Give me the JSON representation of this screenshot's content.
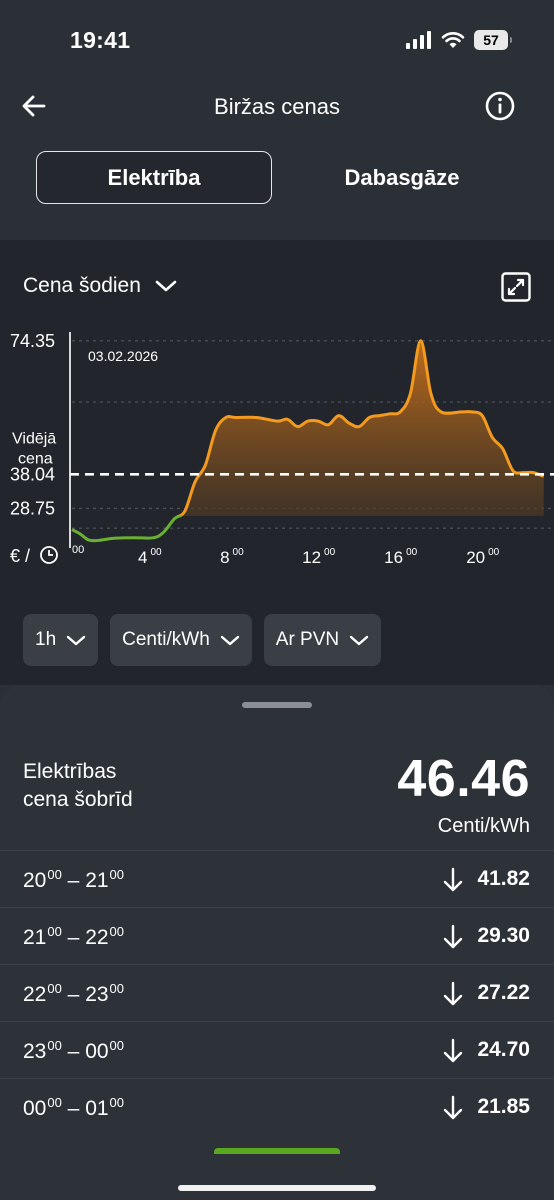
{
  "status": {
    "time": "19:41",
    "battery": "57"
  },
  "header": {
    "title": "Biržas cenas"
  },
  "tabs": {
    "electricity": "Elektrība",
    "gas": "Dabasgāze"
  },
  "chart": {
    "period_label": "Cena šodien",
    "date_label": "03.02.2026",
    "avg_label_line1": "Vidējā",
    "avg_label_line2": "cena",
    "unit_axis_label": "€ /"
  },
  "chart_data": {
    "type": "line",
    "title": "",
    "xlabel": "",
    "ylabel": "",
    "y_ticks": [
      "74.35",
      "38.04",
      "28.75"
    ],
    "x_ticks": [
      {
        "hour": "00",
        "mins": ""
      },
      {
        "hour": "4",
        "mins": "00"
      },
      {
        "hour": "8",
        "mins": "00"
      },
      {
        "hour": "12",
        "mins": "00"
      },
      {
        "hour": "16",
        "mins": "00"
      },
      {
        "hour": "20",
        "mins": "00"
      }
    ],
    "max": 74.35,
    "average": 38.04,
    "min": 28.75,
    "x": [
      0,
      0.4,
      0.8,
      1.2,
      1.6,
      2,
      3,
      4,
      4.5,
      5,
      5.5,
      6,
      6.5,
      7,
      7.5,
      8,
      9,
      10,
      10.5,
      11,
      11.5,
      12,
      12.5,
      13,
      13.5,
      14,
      14.5,
      15,
      15.5,
      16,
      16.5,
      17,
      17.5,
      18,
      19,
      19.5,
      20,
      20.5,
      21,
      21.5,
      22,
      22.5,
      23
    ],
    "y": [
      23.0,
      21.8,
      20.2,
      20.0,
      20.3,
      20.6,
      20.8,
      20.8,
      22.5,
      26.0,
      28.0,
      36.0,
      40.5,
      50.0,
      53.5,
      53.5,
      53.5,
      52.5,
      53.0,
      51.0,
      52.5,
      52.5,
      51.5,
      54.0,
      52.0,
      51.0,
      53.5,
      54.0,
      54.5,
      55.0,
      60.0,
      74.35,
      60.0,
      55.0,
      55.0,
      55.0,
      54.0,
      48.0,
      45.0,
      39.0,
      38.5,
      38.5,
      37.5
    ],
    "series": [
      {
        "name": "",
        "color_above": "#f39a1f",
        "color_below": "#6ab033"
      }
    ],
    "ylim": [
      18,
      80
    ],
    "xlim": [
      0,
      23.5
    ]
  },
  "filters": {
    "interval": "1h",
    "unit": "Centi/kWh",
    "vat": "Ar PVN"
  },
  "current": {
    "label": "Elektrības\ncena šobrīd",
    "value": "46.46",
    "unit": "Centi/kWh"
  },
  "rows": [
    {
      "start_h": "20",
      "start_m": "00",
      "end_h": "21",
      "end_m": "00",
      "price": "41.82"
    },
    {
      "start_h": "21",
      "start_m": "00",
      "end_h": "22",
      "end_m": "00",
      "price": "29.30"
    },
    {
      "start_h": "22",
      "start_m": "00",
      "end_h": "23",
      "end_m": "00",
      "price": "27.22"
    },
    {
      "start_h": "23",
      "start_m": "00",
      "end_h": "00",
      "end_m": "00",
      "price": "24.70"
    },
    {
      "start_h": "00",
      "start_m": "00",
      "end_h": "01",
      "end_m": "00",
      "price": "21.85"
    }
  ],
  "colors": {
    "accent_orange": "#f39a1f",
    "accent_green": "#6ab033",
    "background": "#2b2f36"
  },
  "icons": [
    "back-arrow-icon",
    "info-icon",
    "chevron-down-icon",
    "expand-icon",
    "arrow-down-icon",
    "clock-icon",
    "signal-icon",
    "wifi-icon",
    "battery-icon"
  ]
}
